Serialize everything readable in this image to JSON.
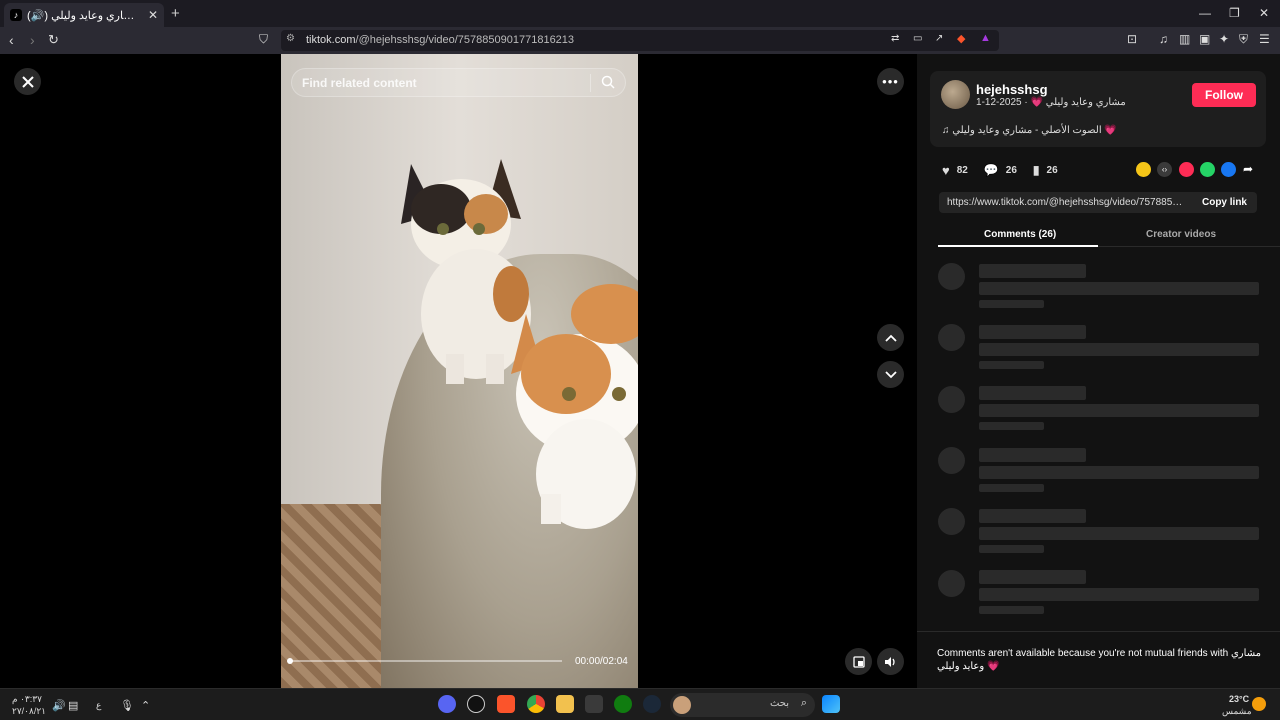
{
  "browser": {
    "tab_title": "(🔊) مشاري وعايد وليلي 💗",
    "tab_favicon": "tiktok-icon",
    "url_host": "tiktok.com",
    "url_path": "/@hejehsshsg/video/7578850901771816213"
  },
  "video": {
    "search_placeholder": "Find related content",
    "timecode": "00:00/02:04",
    "progress": 0.0
  },
  "post": {
    "username": "hejehsshsg",
    "meta": "مشاري وعايد وليلي 💗 · 2025-12-1",
    "follow_label": "Follow",
    "music": "الصوت الأصلي - مشاري وعايد وليلي 💗",
    "likes": "82",
    "comments": "26",
    "saves": "26",
    "share_link": "https://www.tiktok.com/@hejehsshsg/video/75788509...",
    "copy_label": "Copy link"
  },
  "tabs": {
    "comments": "Comments (26)",
    "creator": "Creator videos"
  },
  "notice": "Comments aren't available because you're not mutual friends with مشاري وعايد وليلي 💗",
  "taskbar": {
    "search_label": "بحث",
    "weather_temp": "23°C",
    "weather_desc": "مشمس",
    "time": "٠٣:٣٧ م",
    "date": "٢٧/٠٨/٢١",
    "lang": "ع"
  },
  "colors": {
    "accent": "#fe2c55",
    "panel_bg": "#121212",
    "chrome_bg": "#2b2a33"
  }
}
